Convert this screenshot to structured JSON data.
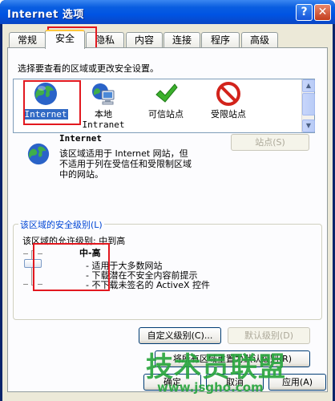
{
  "window": {
    "title": "Internet 选项"
  },
  "titlebar_buttons": {
    "help": "?",
    "close": "✕"
  },
  "tabs": [
    {
      "label": "常规"
    },
    {
      "label": "安全"
    },
    {
      "label": "隐私"
    },
    {
      "label": "内容"
    },
    {
      "label": "连接"
    },
    {
      "label": "程序"
    },
    {
      "label": "高级"
    }
  ],
  "active_tab": "安全",
  "security": {
    "instruction": "选择要查看的区域或更改安全设置。",
    "zones": [
      {
        "label": "Internet",
        "label2": "",
        "icon": "globe-icon",
        "selected": true
      },
      {
        "label": "本地",
        "label2": "Intranet",
        "icon": "computer-network-icon",
        "selected": false
      },
      {
        "label": "可信站点",
        "label2": "",
        "icon": "checkmark-icon",
        "selected": false
      },
      {
        "label": "受限站点",
        "label2": "",
        "icon": "prohibited-icon",
        "selected": false
      }
    ],
    "zone_info": {
      "title": "Internet",
      "desc_line1": "该区域适用于 Internet 网站，但",
      "desc_line2": "不适用于列在受信任和受限制区域",
      "desc_line3": "中的网站。"
    },
    "sites_button": "站点(S)",
    "level_group_title": "该区域的安全级别(L)",
    "allowed_level": "该区域的允许级别: 中到高",
    "level_name": "中-高",
    "level_bullets": [
      "- 适用于大多数网站",
      "- 下载潜在不安全内容前提示",
      "- 不下载未签名的 ActiveX 控件"
    ],
    "slider_level": 0.5,
    "custom_level_button": "自定义级别(C)...",
    "default_level_button": "默认级别(D)",
    "reset_all_button": "将所有区域重置为默认级别(R)"
  },
  "bottom_buttons": {
    "ok": "确定",
    "cancel": "取消",
    "apply": "应用(A)"
  },
  "watermark": {
    "text": "技术员联盟",
    "url": "www.jsgho.com"
  },
  "colors": {
    "titlebar": "#0054e3",
    "selection": "#316ac5",
    "highlight_box": "#e2181f",
    "watermark": "#2aa63f"
  }
}
